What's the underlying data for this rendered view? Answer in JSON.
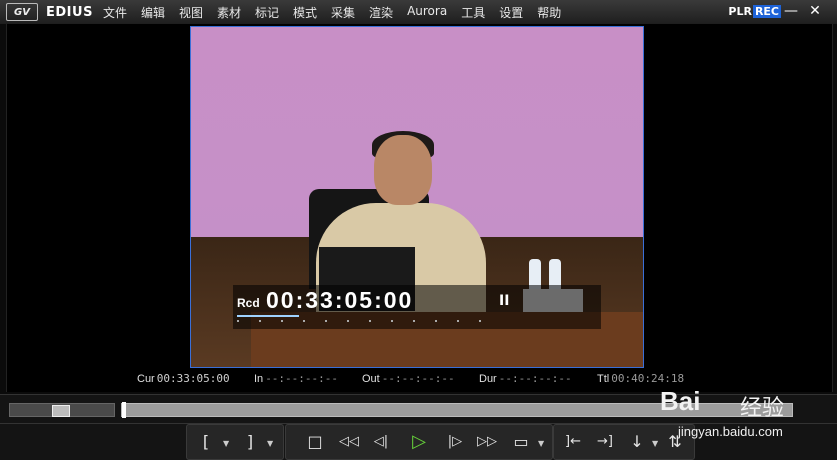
{
  "app": {
    "logo": "GV",
    "name": "EDIUS"
  },
  "menu": [
    "文件",
    "编辑",
    "视图",
    "素材",
    "标记",
    "模式",
    "采集",
    "渲染",
    "Aurora",
    "工具",
    "设置",
    "帮助"
  ],
  "mode": {
    "plr": "PLR",
    "rec": "REC"
  },
  "window": {
    "minimize": "—",
    "close": "✕"
  },
  "overlay": {
    "label": "Rcd",
    "timecode": "00:33:05:00",
    "pause": "II"
  },
  "timecodes": {
    "cur": {
      "label": "Cur",
      "value": "00:33:05:00"
    },
    "in": {
      "label": "In",
      "value": "--:--:--:--"
    },
    "out": {
      "label": "Out",
      "value": "--:--:--:--"
    },
    "dur": {
      "label": "Dur",
      "value": "--:--:--:--"
    },
    "ttl": {
      "label": "Ttl",
      "value": "00:40:24:18"
    }
  },
  "transport": {
    "set_in": "[",
    "set_out": "]",
    "stop": "□",
    "rewind": "◁◁",
    "step_back": "◁|",
    "play": "▷",
    "step_forward": "|▷",
    "fast_forward": "▷▷",
    "loop": "▭",
    "insert": "]←",
    "overwrite": "→]",
    "replace": "↓",
    "extra": "⇅"
  },
  "watermark": {
    "brand": "Bai",
    "brand_cn": "经验",
    "url": "jingyan.baidu.com"
  },
  "colors": {
    "accent": "#1e63d8",
    "play": "#66d13a"
  }
}
